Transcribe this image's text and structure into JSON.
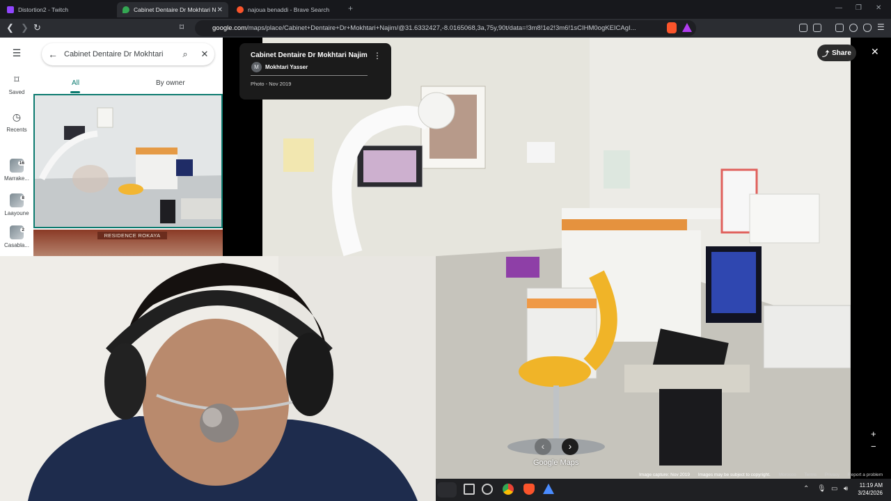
{
  "browser": {
    "tabs": [
      {
        "label": "Distortion2 - Twitch",
        "active": false,
        "color": "#9146ff"
      },
      {
        "label": "Cabinet Dentaire Dr Mokhtari N...",
        "active": true,
        "color": "#34a853"
      },
      {
        "label": "najoua benaddi - Brave Search",
        "active": false,
        "color": "#fb542b"
      }
    ],
    "url_domain": "google.com",
    "url_path": "/maps/place/Cabinet+Dentaire+Dr+Mokhtari+Najim/@31.6332427,-8.0165068,3a,75y,90t/data=!3m8!1e2!3m6!1sCIHM0ogKEICAgI..."
  },
  "maps": {
    "rail": {
      "saved_label": "Saved",
      "recents_label": "Recents",
      "recent_places": [
        {
          "label": "Marrake...",
          "count": "16"
        },
        {
          "label": "Laayoune",
          "count": "8"
        },
        {
          "label": "Casabla...",
          "count": "2"
        }
      ]
    },
    "search": {
      "query": "Cabinet Dentaire Dr Mokhtari"
    },
    "photo_tabs": {
      "all": "All",
      "by_owner": "By owner"
    },
    "second_photo_sign": "RESIDENCE ROKAYA",
    "viewer": {
      "place_title": "Cabinet Dentaire Dr Mokhtari Najim",
      "author_initial": "M",
      "author": "Mokhtari Yasser",
      "photo_date": "Photo - Nov 2019",
      "share_label": "Share",
      "brand": "Google Maps",
      "footer": {
        "capture": "Image capture: Nov 2019",
        "copyright": "Images may be subject to copyright.",
        "country": "Morocco",
        "terms": "Terms",
        "privacy": "Privacy",
        "report": "Report a problem"
      }
    }
  },
  "taskbar": {
    "time": "11:19 AM",
    "date": "3/24/2026"
  }
}
